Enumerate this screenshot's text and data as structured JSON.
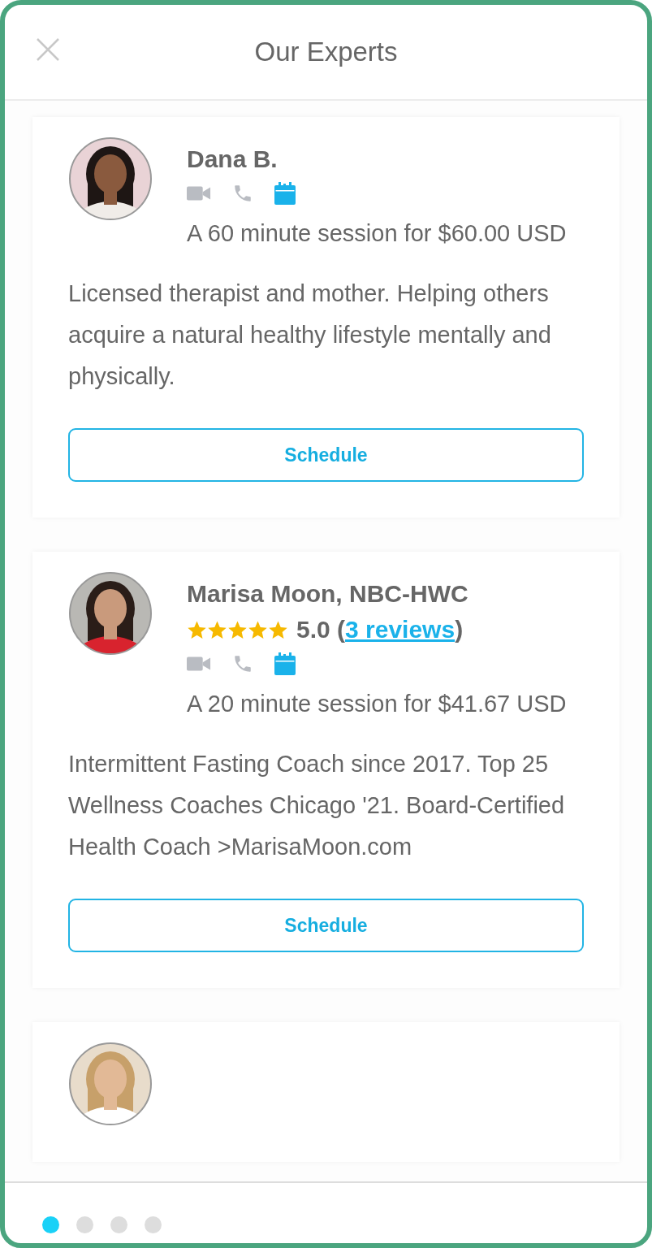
{
  "header": {
    "title": "Our Experts"
  },
  "experts": [
    {
      "avatar": {
        "kind": "picture"
      },
      "name": "Dana B.",
      "modes": [
        {
          "kind": "video",
          "available": false
        },
        {
          "kind": "phone",
          "available": false
        },
        {
          "kind": "calendar",
          "available": true
        }
      ],
      "session": "A 60 minute session for $60.00 USD",
      "bio": "Licensed therapist and mother. Helping others acquire a natural healthy lifestyle mentally and physically.",
      "button": "Schedule"
    },
    {
      "avatar": {
        "kind": "picture"
      },
      "name": "Marisa Moon, NBC-HWC",
      "rating": {
        "stars": 5,
        "prefix": "5.0 (",
        "link": "3 reviews",
        "suffix": ")"
      },
      "modes": [
        {
          "kind": "video",
          "available": false
        },
        {
          "kind": "phone",
          "available": false
        },
        {
          "kind": "calendar",
          "available": true
        }
      ],
      "session": "A 20 minute session for $41.67 USD",
      "bio": "Intermittent Fasting Coach since 2017. Top 25 Wellness Coaches Chicago '21. Board-Certified Health Coach >MarisaMoon.com",
      "button": "Schedule"
    },
    {
      "avatar": {
        "kind": "picture"
      }
    }
  ],
  "pager": [
    {
      "selected": true
    },
    {
      "selected": false
    },
    {
      "selected": false
    },
    {
      "selected": false
    }
  ]
}
